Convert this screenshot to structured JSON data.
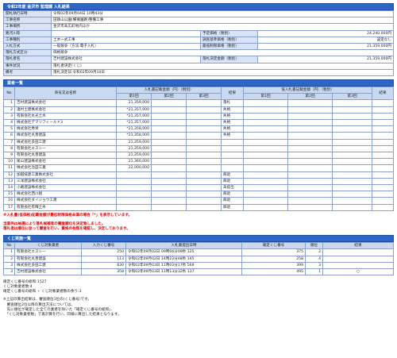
{
  "header": {
    "title": "令和2年度 金沢市 監理課 入札結果"
  },
  "info": [
    {
      "label": "開札執行日時",
      "value": "令和02年09月04日 10時43分"
    },
    {
      "label": "工事名称",
      "value": "田鉄山公園(備擁園路)整備工事"
    },
    {
      "label": "工事場所",
      "value": "金沢市末広町地内ほか"
    },
    {
      "label": "路河川等",
      "value": "",
      "label2": "予定価格（税別）",
      "value2": "24,240,000円"
    },
    {
      "label": "工事種別",
      "value": "土木一式工事",
      "label2": "調査基準価格（税別）",
      "value2": "設定なし"
    },
    {
      "label": "入札方式",
      "value": "一般競争（方法:電子入札）",
      "label2": "最低制限価格（税別）",
      "value2": "21,359,000円"
    },
    {
      "label": "落札方式区分",
      "value": "価格競争"
    },
    {
      "label": "落札者名",
      "value": "吉村建設株式会社",
      "label2": "落札決定金額（税別）",
      "value2": "21,359,000円"
    },
    {
      "label": "事件状況",
      "value": "落札者決定(くじ)"
    },
    {
      "label": "備考",
      "value": "落札決定日:令和02年09月10日"
    }
  ],
  "bidders_title": "業者一覧",
  "bid_headers": {
    "no": "No",
    "name": "商号又は名称",
    "amount_group": "入札書記載金額（円）（税別）",
    "round1": "第1回",
    "round2": "第2回",
    "round3": "第3回",
    "result": "結果",
    "low_group": "低入札書記載金額（円）（税別）",
    "lround1": "第1回",
    "lround2": "第2回",
    "lround3": "第3回",
    "lresult": "結果"
  },
  "bidders": [
    {
      "no": "1",
      "name": "吉村建設株式会社",
      "r1": "21,359,000",
      "result": "落札"
    },
    {
      "no": "2",
      "name": "凄村土建株式会社",
      "r1": "*21,357,000",
      "result": "失格"
    },
    {
      "no": "3",
      "name": "有限会社丸光土木",
      "r1": "*21,357,000",
      "result": "失格"
    },
    {
      "no": "4",
      "name": "株式会社デマツフィールド3",
      "r1": "*21,357,000",
      "result": "失格"
    },
    {
      "no": "5",
      "name": "株式会社秀栄",
      "r1": "*21,358,000",
      "result": "失格"
    },
    {
      "no": "6",
      "name": "株式会社丸善建設",
      "r1": "*21,358,000",
      "result": "失格"
    },
    {
      "no": "7",
      "name": "株式会社多田工建",
      "r1": "21,359,000",
      "result": ""
    },
    {
      "no": "8",
      "name": "有限会社エスシー",
      "r1": "21,359,000",
      "result": ""
    },
    {
      "no": "9",
      "name": "有限会社丸善建設",
      "r1": "21,359,000",
      "result": ""
    },
    {
      "no": "10",
      "name": "尾山建設株式会社",
      "r1": "21,360,000",
      "result": ""
    },
    {
      "no": "11",
      "name": "株式会社治田工業",
      "r1": "22,000,000",
      "result": ""
    },
    {
      "no": "12",
      "name": "加越技建工業株式会社",
      "r1": "",
      "result": "辞退"
    },
    {
      "no": "13",
      "name": "三洋建設株式会社",
      "r1": "",
      "result": "辞退"
    },
    {
      "no": "14",
      "name": "小路建設株式会社",
      "r1": "",
      "result": "未提出"
    },
    {
      "no": "15",
      "name": "株式会社西川組",
      "r1": "",
      "result": "辞退"
    },
    {
      "no": "16",
      "name": "株式会社ダイジョウ工建",
      "r1": "",
      "result": "辞退"
    },
    {
      "no": "17",
      "name": "有限会社有輝土木",
      "r1": "",
      "result": "辞退"
    }
  ],
  "notes_red": [
    "※入札書(低価格)記載金額が最低制限価格未満の場合「*」を表示しています。",
    "当案件は抽選により落札候補者の審査順位を決定致しました。",
    "落札者は順位に従って審査を行い、資格の有無を確認し、決定しております。"
  ],
  "lottery_title": "くじ実施一覧",
  "lot_headers": {
    "no": "No",
    "name": "くじ対象業者",
    "input": "入力くじ番号",
    "datetime": "入札書提出日時",
    "confirmed": "確定くじ番号",
    "rank": "順位",
    "result": "結果"
  },
  "lottery": [
    {
      "no": "1",
      "name": "有限会社エスシー",
      "input": "250",
      "datetime": "令和02年09月02日 09時06分09秒 125",
      "confirmed": "375",
      "rank": "2",
      "result": ""
    },
    {
      "no": "2",
      "name": "有限会社丸善建設",
      "input": "113",
      "datetime": "令和02年09月02日 14時22分48秒 145",
      "confirmed": "258",
      "rank": "4",
      "result": ""
    },
    {
      "no": "3",
      "name": "株式会社多田工建",
      "input": "830",
      "datetime": "令和02年09月03日 11時02分17秒 569",
      "confirmed": "399",
      "rank": "3",
      "result": ""
    },
    {
      "no": "3",
      "name": "吉村建設株式会社",
      "input": "358",
      "datetime": "令和02年09月03日 11時13分32秒 137",
      "confirmed": "495",
      "rank": "1",
      "result": "○"
    }
  ],
  "summary": [
    "確定くじ番号の総和:1527",
    "くじ対象業者数:4",
    "確定くじ番号の総和 ÷ くじ対象業者数の余り:3"
  ],
  "footnotes": [
    "※上記の算出結果は、審査順位1位の(くじ番号)です。",
    "　審査順位2位以降の算出方法については、",
    "　先に順位が確定した全ての業者を除いた「確定くじ番号の総和」、",
    "　「くじ対象業者数」で再計算を行い、同様に算出した結果となります。"
  ]
}
